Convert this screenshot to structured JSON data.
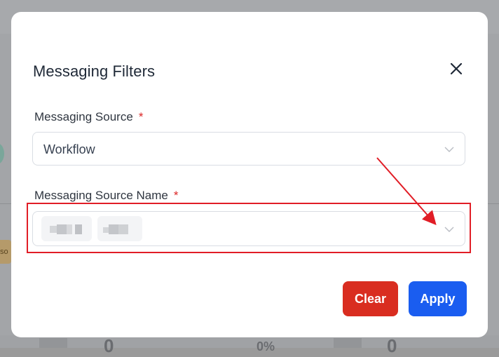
{
  "modal": {
    "title": "Messaging Filters"
  },
  "fields": {
    "source": {
      "label": "Messaging Source",
      "required_mark": "*",
      "value": "Workflow"
    },
    "source_name": {
      "label": "Messaging Source Name",
      "required_mark": "*"
    }
  },
  "buttons": {
    "clear": "Clear",
    "apply": "Apply"
  },
  "background": {
    "chip_text": "so",
    "metric_left": "0",
    "metric_mid": "0%",
    "metric_right": "0"
  },
  "colors": {
    "primary": "#1a5df0",
    "danger": "#d92d20",
    "annotation": "#e11d26"
  }
}
